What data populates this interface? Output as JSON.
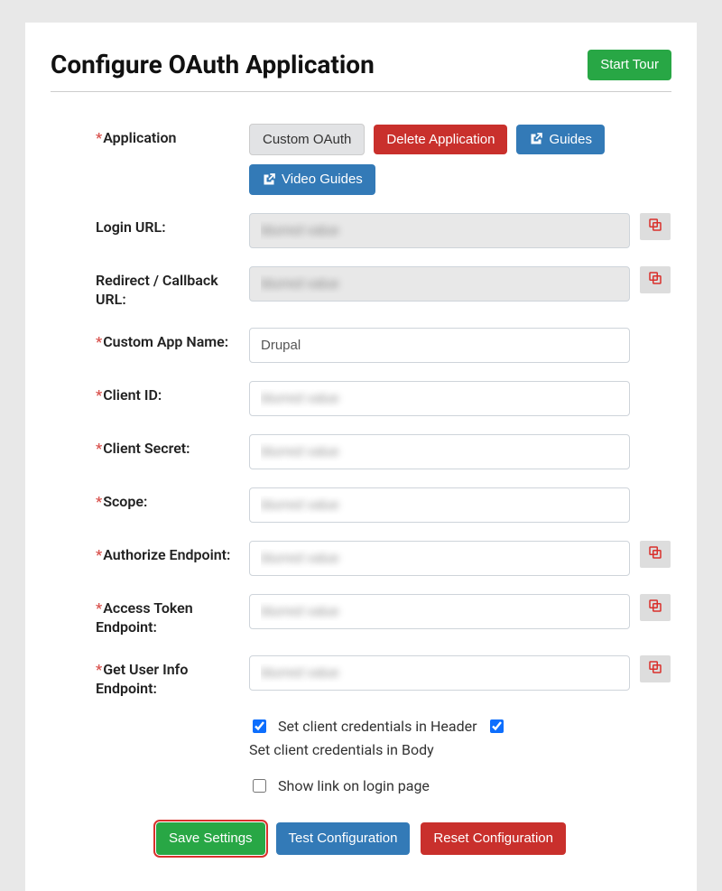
{
  "header": {
    "title": "Configure OAuth Application",
    "start_tour": "Start Tour"
  },
  "app_row": {
    "label": "Application",
    "required": true,
    "selected": "Custom OAuth",
    "delete": "Delete Application",
    "guides": "Guides",
    "video_guides": "Video Guides"
  },
  "fields": {
    "login_url": {
      "label": "Login URL:",
      "required": false,
      "value": "blurred value",
      "readonly": true,
      "copy": true
    },
    "redirect": {
      "label": "Redirect / Callback URL:",
      "required": false,
      "value": "blurred value",
      "readonly": true,
      "copy": true
    },
    "custom_app": {
      "label": "Custom App Name:",
      "required": true,
      "value": "Drupal"
    },
    "client_id": {
      "label": "Client ID:",
      "required": true,
      "value": "blurred value",
      "blur": true
    },
    "client_secret": {
      "label": "Client Secret:",
      "required": true,
      "value": "blurred value",
      "blur": true
    },
    "scope": {
      "label": "Scope:",
      "required": true,
      "value": "blurred value",
      "blur": true
    },
    "authorize": {
      "label": "Authorize Endpoint:",
      "required": true,
      "value": "blurred value",
      "blur": true,
      "copy": true
    },
    "access_token": {
      "label": "Access Token Endpoint:",
      "required": true,
      "value": "blurred value",
      "blur": true,
      "copy": true
    },
    "userinfo": {
      "label": "Get User Info Endpoint:",
      "required": true,
      "value": "blurred value",
      "blur": true,
      "copy": true
    }
  },
  "checkboxes": {
    "header": {
      "label": "Set client credentials in Header",
      "checked": true
    },
    "body": {
      "label": "Set client credentials in Body",
      "checked": true
    },
    "show_link": {
      "label": "Show link on login page",
      "checked": false
    }
  },
  "footer": {
    "save": "Save Settings",
    "test": "Test Configuration",
    "reset": "Reset Configuration"
  }
}
